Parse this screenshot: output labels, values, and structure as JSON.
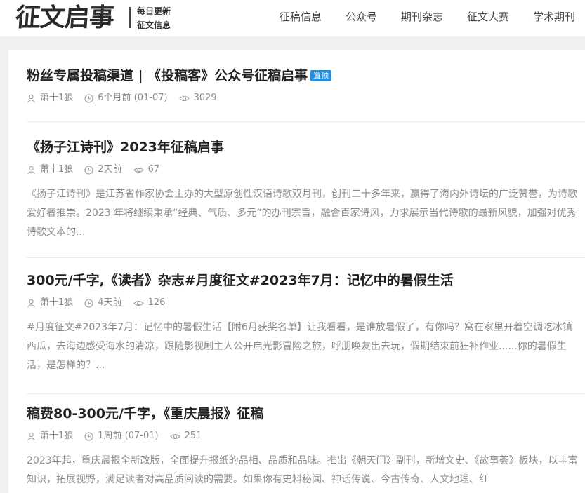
{
  "header": {
    "logo": "征文启事",
    "slogan_line1": "每日更新",
    "slogan_line2": "征文信息",
    "nav": [
      "征稿信息",
      "公众号",
      "期刊杂志",
      "征文大赛",
      "学术期刊"
    ]
  },
  "posts": [
    {
      "title": "粉丝专属投稿渠道 | 《投稿客》公众号征稿启事",
      "badge": "置顶",
      "author": "萧十1狼",
      "time": "6个月前 (01-07)",
      "views": "3029"
    },
    {
      "title": "《扬子江诗刊》2023年征稿启事",
      "author": "萧十1狼",
      "time": "2天前",
      "views": "67",
      "excerpt": "《扬子江诗刊》是江苏省作家协会主办的大型原创性汉语诗歌双月刊，创刊二十多年来，赢得了海内外诗坛的广泛赞誉，为诗歌爱好者推崇。2023 年将继续秉承“经典、气质、多元”的办刊宗旨，融合百家诗风，力求展示当代诗歌的最新风貌，加强对优秀诗歌文本的..."
    },
    {
      "title": "300元/千字,《读者》杂志#月度征文#2023年7月：记忆中的暑假生活",
      "author": "萧十1狼",
      "time": "4天前",
      "views": "126",
      "excerpt": "#月度征文#2023年7月：记忆中的暑假生活【附6月获奖名单】让我看看，是谁放暑假了，有你吗？窝在家里开着空调吃冰镇西瓜，去海边感受海水的清凉，跟随影视剧主人公开启光影冒险之旅，呼朋唤友出去玩，假期结束前狂补作业......你的暑假生活，是怎样的？..."
    },
    {
      "title": "稿费80-300元/千字，《重庆晨报》征稿",
      "author": "萧十1狼",
      "time": "1周前 (07-01)",
      "views": "251",
      "excerpt": "2023年起，重庆晨报全新改版，全面提升报纸的品相、品质和品味。推出《朝天门》副刊，新增文史、《故事荟》板块，以丰富知识，拓展视野，满足读者对高品质阅读的需要。如果你有史料秘闻、神话传说、今古传奇、人文地理、红"
    }
  ]
}
